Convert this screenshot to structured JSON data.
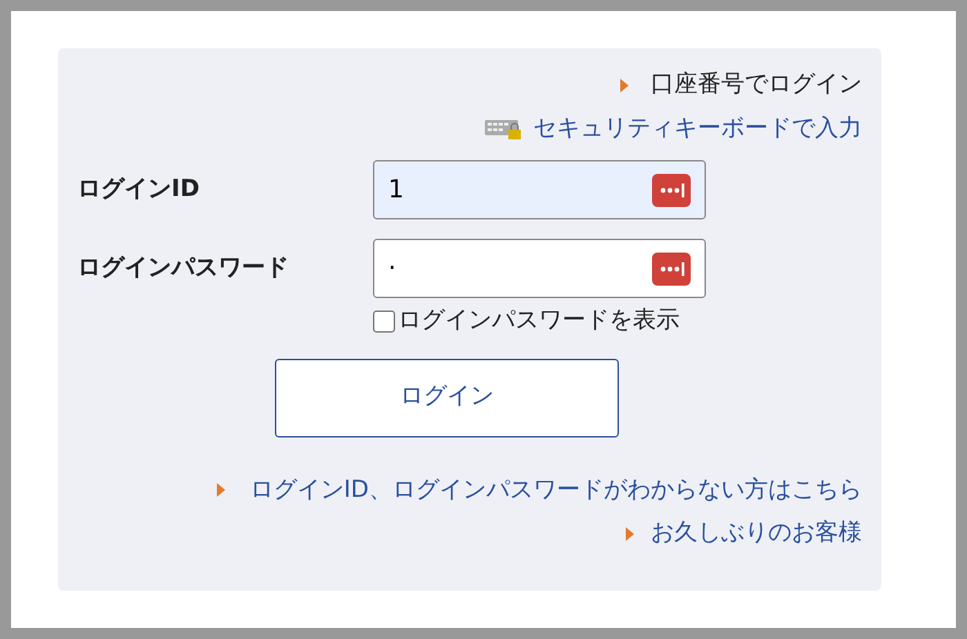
{
  "top_links": [
    {
      "kind": "arrow",
      "text": "口座番号でログイン"
    },
    {
      "kind": "keyboard",
      "text": "セキュリティキーボードで入力"
    }
  ],
  "fields": [
    {
      "label": "ログインID",
      "value": "1",
      "autofilled": true
    },
    {
      "label": "ログインパスワード",
      "value": "·",
      "autofilled": false
    }
  ],
  "show_password": {
    "label": "ログインパスワードを表示",
    "checked": false
  },
  "login_button": "ログイン",
  "bottom_links": [
    "ログインID、ログインパスワードがわからない方はこちら",
    "お久しぶりのお客様"
  ]
}
